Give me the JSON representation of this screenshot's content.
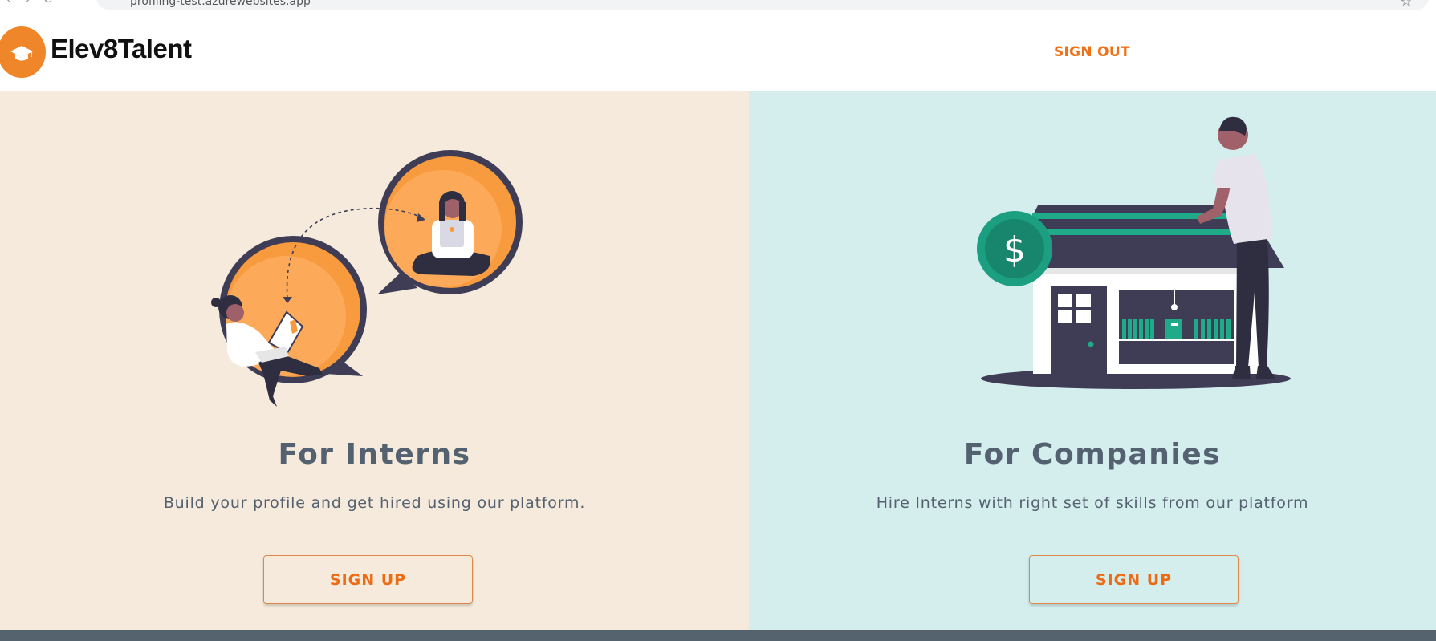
{
  "browser": {
    "url_text": "profiling-test.azurewebsites.app"
  },
  "header": {
    "brand": "Elev8Talent",
    "signout_label": "SIGN OUT"
  },
  "interns": {
    "title": "For Interns",
    "subtitle": "Build your profile and get hired using our platform.",
    "signup_label": "SIGN UP"
  },
  "companies": {
    "title": "For Companies",
    "subtitle": "Hire Interns with right set of skills from our platform",
    "signup_label": "SIGN UP"
  },
  "colors": {
    "accent": "#f07016",
    "interns_bg": "#f5eadc",
    "companies_bg": "#d4eded",
    "footer": "#55636f",
    "heading": "#536170"
  }
}
